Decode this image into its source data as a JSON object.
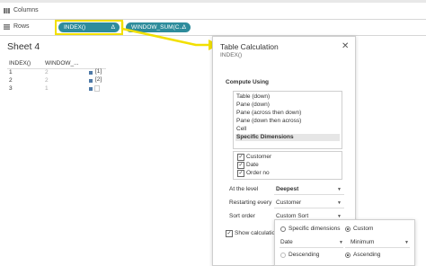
{
  "shelves": {
    "columns_label": "Columns",
    "rows_label": "Rows",
    "pill1": "INDEX()",
    "pill2": "WINDOW_SUM(C...",
    "delta": "Δ"
  },
  "sheet": {
    "title": "Sheet 4",
    "col1": "INDEX()",
    "col2": "WINDOW_...",
    "rows": [
      {
        "index": "1",
        "value": "2",
        "bracket": "[1]"
      },
      {
        "index": "2",
        "value": "2",
        "bracket": "[2]"
      },
      {
        "index": "3",
        "value": "1",
        "bracket": ""
      }
    ]
  },
  "panel": {
    "title": "Table Calculation",
    "subtitle": "INDEX()",
    "compute_using": "Compute Using",
    "options": [
      "Table (down)",
      "Pane (down)",
      "Pane (across then down)",
      "Pane (down then across)",
      "Cell",
      "Specific Dimensions"
    ],
    "dimensions": [
      "Customer",
      "Date",
      "Order no"
    ],
    "at_level_label": "At the level",
    "at_level_value": "Deepest",
    "restarting_label": "Restarting every",
    "restarting_value": "Customer",
    "sort_label": "Sort order",
    "sort_value": "Custom Sort",
    "show_calc": "Show calculatio"
  },
  "popup": {
    "specific": "Specific dimensions",
    "custom": "Custom",
    "field": "Date",
    "agg": "Minimum",
    "descending": "Descending",
    "ascending": "Ascending"
  },
  "colors": {
    "pill": "#2e8c9c",
    "highlight": "#f2e000",
    "accent": "#4e79a7"
  }
}
